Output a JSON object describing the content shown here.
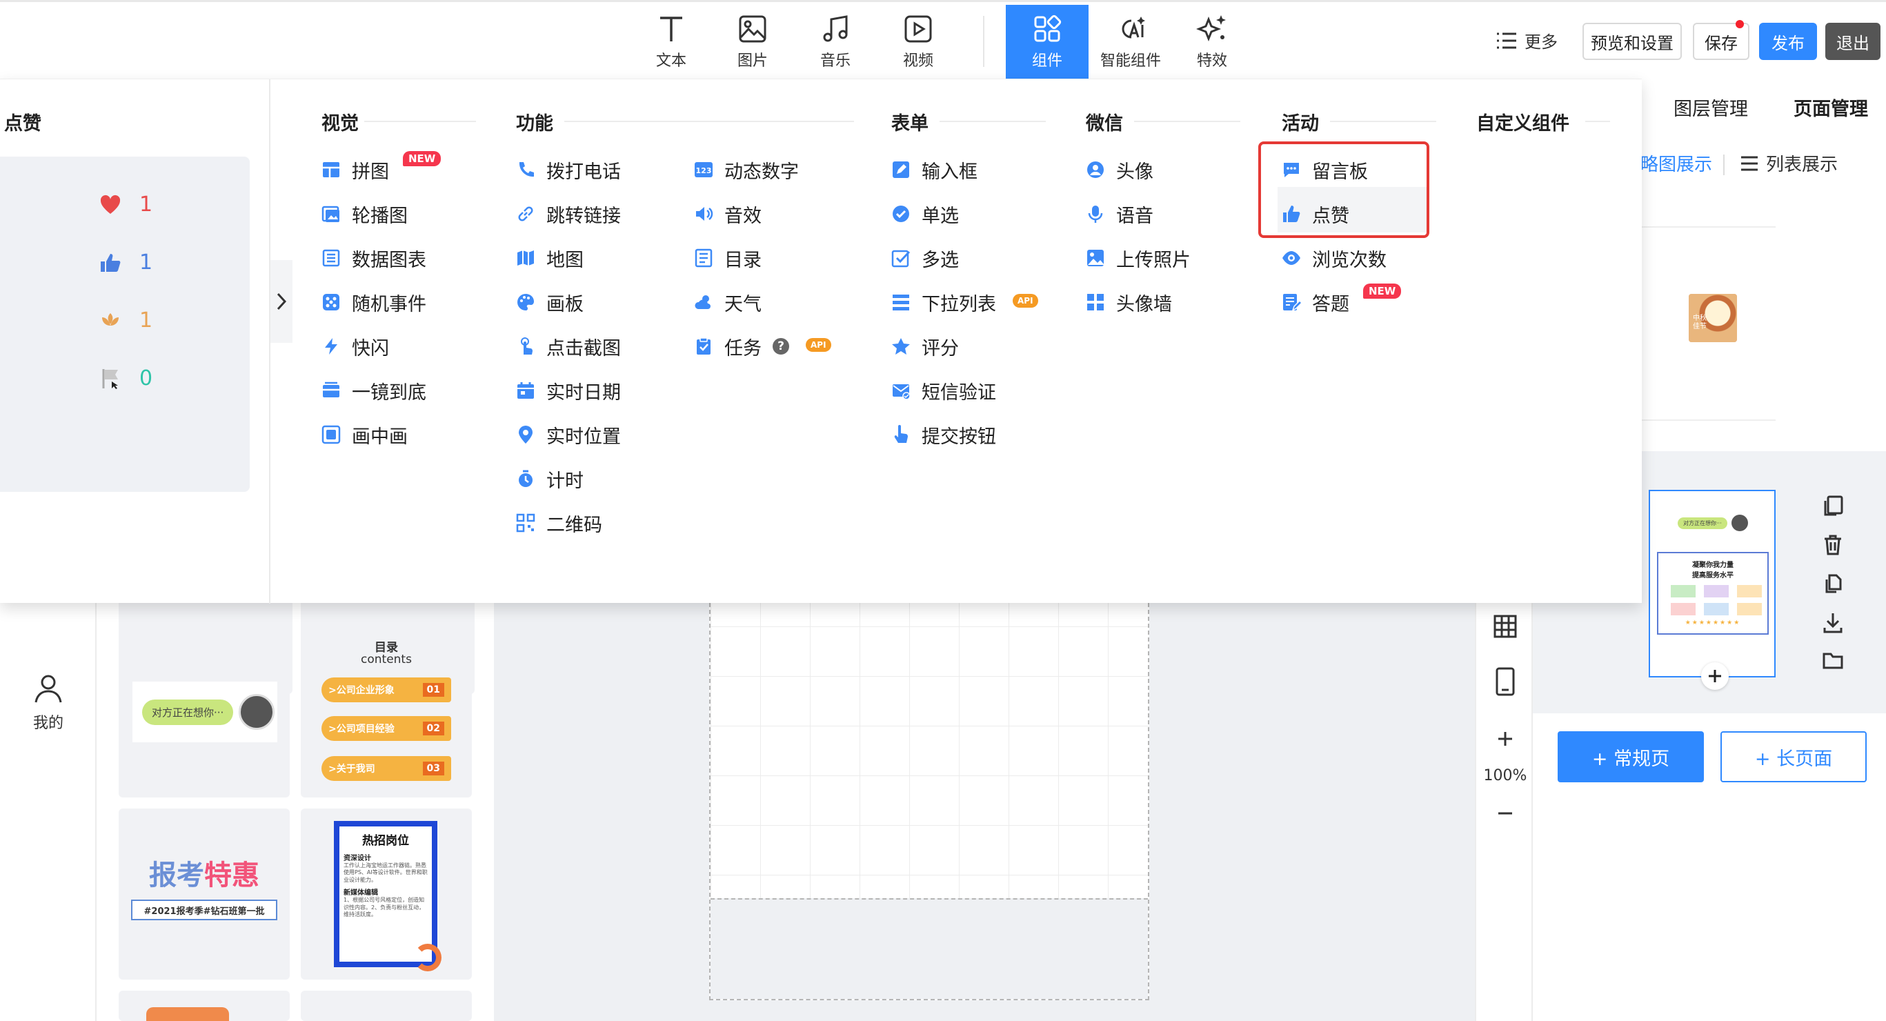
{
  "toolbar": {
    "items": [
      {
        "label": "文本",
        "icon": "text-icon"
      },
      {
        "label": "图片",
        "icon": "image-icon"
      },
      {
        "label": "音乐",
        "icon": "music-icon"
      },
      {
        "label": "视频",
        "icon": "video-icon"
      },
      {
        "label": "组件",
        "icon": "components-icon",
        "active": true
      },
      {
        "label": "智能组件",
        "icon": "ai-icon"
      },
      {
        "label": "特效",
        "icon": "sparkle-icon"
      }
    ],
    "more": "更多",
    "preview": "预览和设置",
    "save": "保存",
    "publish": "发布",
    "exit": "退出"
  },
  "left_nav": {
    "mine": "我的"
  },
  "templates": {
    "card1_text": "对方正在想你···",
    "card2_title": "目录",
    "card2_sub": "contents",
    "card2_rows": [
      {
        "label": ">公司企业形象",
        "num": "01"
      },
      {
        "label": ">公司项目经验",
        "num": "02"
      },
      {
        "label": ">关于我司",
        "num": "03"
      }
    ],
    "card3_title_a": "报考",
    "card3_title_b": "特惠",
    "card3_sub": "#2021报考季#钻石班第一批",
    "card4_title": "热招岗位",
    "card4_h1": "资深设计",
    "card4_p1": "工作认上海宝地运工作器链。熟悉使用PS、AI等设计软件。世界和职业设计能力。",
    "card4_h2": "新媒体编辑",
    "card4_p2": "1、根据公司号风格定位，创造知识性内容。2、负责与粉丝互动，维持活跃度。"
  },
  "zoom": "100%",
  "right_panel": {
    "tab_layers": "图层管理",
    "tab_pages": "页面管理",
    "view_thumb": "缩略图展示",
    "view_list": "列表展示",
    "btn_normal": "+ 常规页",
    "btn_long": "+ 长页面",
    "thumb_bubble": "对方正在想你···",
    "thumb_title": "凝聚你我力量",
    "thumb_sub": "提高服务水平",
    "mini_text": "中秋佳节"
  },
  "dropdown": {
    "preview_title": "点赞",
    "likes": [
      {
        "icon": "heart-icon",
        "count": "1",
        "color": "#e84a4a"
      },
      {
        "icon": "thumbs-up-icon",
        "count": "1",
        "color": "#4a7fe0"
      },
      {
        "icon": "lotus-icon",
        "count": "1",
        "color": "#e8a355"
      },
      {
        "icon": "flag-icon",
        "count": "0",
        "color": "#2fc4a8"
      }
    ],
    "categories": {
      "visual": {
        "title": "视觉",
        "items": [
          {
            "label": "拼图",
            "icon": "puzzle-layout-icon",
            "badge": "NEW"
          },
          {
            "label": "轮播图",
            "icon": "carousel-icon"
          },
          {
            "label": "数据图表",
            "icon": "data-chart-icon"
          },
          {
            "label": "随机事件",
            "icon": "dice-icon"
          },
          {
            "label": "快闪",
            "icon": "lightning-icon"
          },
          {
            "label": "一镜到底",
            "icon": "long-shot-icon"
          },
          {
            "label": "画中画",
            "icon": "picture-in-picture-icon"
          }
        ]
      },
      "function": {
        "title": "功能",
        "col1": [
          {
            "label": "拨打电话",
            "icon": "phone-icon"
          },
          {
            "label": "跳转链接",
            "icon": "link-icon"
          },
          {
            "label": "地图",
            "icon": "map-icon"
          },
          {
            "label": "画板",
            "icon": "palette-icon"
          },
          {
            "label": "点击截图",
            "icon": "tap-screenshot-icon"
          },
          {
            "label": "实时日期",
            "icon": "calendar-icon"
          },
          {
            "label": "实时位置",
            "icon": "location-pin-icon"
          },
          {
            "label": "计时",
            "icon": "timer-icon"
          },
          {
            "label": "二维码",
            "icon": "qrcode-icon"
          }
        ],
        "col2": [
          {
            "label": "动态数字",
            "icon": "number-123-icon"
          },
          {
            "label": "音效",
            "icon": "speaker-icon"
          },
          {
            "label": "目录",
            "icon": "catalog-icon"
          },
          {
            "label": "天气",
            "icon": "weather-icon"
          },
          {
            "label": "任务",
            "icon": "task-icon",
            "help": "?",
            "badge": "API"
          }
        ]
      },
      "form": {
        "title": "表单",
        "items": [
          {
            "label": "输入框",
            "icon": "input-icon"
          },
          {
            "label": "单选",
            "icon": "radio-check-icon"
          },
          {
            "label": "多选",
            "icon": "checkbox-icon"
          },
          {
            "label": "下拉列表",
            "icon": "dropdown-list-icon",
            "badge": "API"
          },
          {
            "label": "评分",
            "icon": "star-icon"
          },
          {
            "label": "短信验证",
            "icon": "sms-verify-icon"
          },
          {
            "label": "提交按钮",
            "icon": "pointer-hand-icon"
          }
        ]
      },
      "wechat": {
        "title": "微信",
        "items": [
          {
            "label": "头像",
            "icon": "avatar-icon"
          },
          {
            "label": "语音",
            "icon": "microphone-icon"
          },
          {
            "label": "上传照片",
            "icon": "upload-photo-icon"
          },
          {
            "label": "头像墙",
            "icon": "avatar-wall-icon"
          }
        ]
      },
      "activity": {
        "title": "活动",
        "items": [
          {
            "label": "留言板",
            "icon": "message-board-icon"
          },
          {
            "label": "点赞",
            "icon": "thumbs-up-icon"
          },
          {
            "label": "浏览次数",
            "icon": "eye-icon"
          },
          {
            "label": "答题",
            "icon": "quiz-icon",
            "badge": "NEW"
          }
        ]
      },
      "custom": {
        "title": "自定义组件"
      }
    }
  },
  "colors": {
    "accent": "#2f89ff",
    "highlight_border": "#e53935",
    "icon_blue": "#3d8af7"
  }
}
